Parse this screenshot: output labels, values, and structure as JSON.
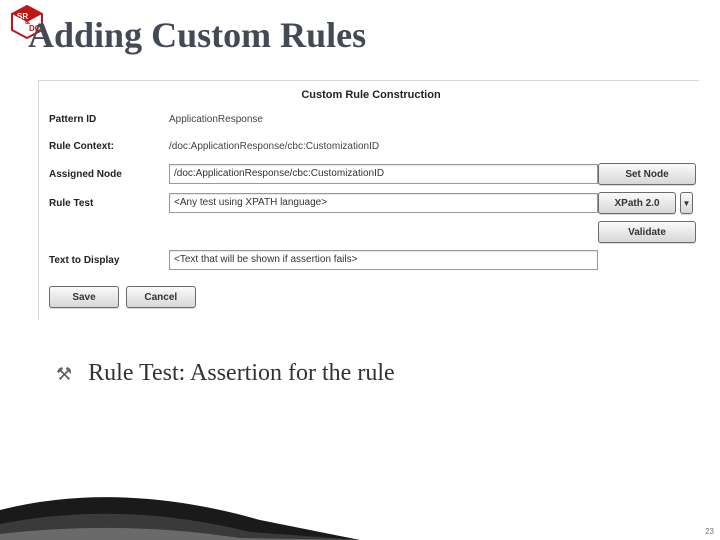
{
  "slide": {
    "title": "Adding Custom Rules",
    "page_number": "23",
    "bullet_glyph": "⚒",
    "bullet_text": "Rule Test: Assertion for the rule"
  },
  "logo": {
    "text_left": "SR",
    "amp": "&",
    "text_right": "DC"
  },
  "panel": {
    "header": "Custom Rule Construction",
    "rows": {
      "pattern_id": {
        "label": "Pattern ID",
        "value": "ApplicationResponse"
      },
      "rule_context": {
        "label": "Rule Context:",
        "value": "/doc:ApplicationResponse/cbc:CustomizationID"
      },
      "assigned_node": {
        "label": "Assigned Node",
        "value": "/doc:ApplicationResponse/cbc:CustomizationID",
        "button": "Set Node"
      },
      "rule_test": {
        "label": "Rule Test",
        "value": "<Any test using XPATH language>",
        "xpath_btn": "XPath 2.0",
        "validate_btn": "Validate"
      },
      "text_to_display": {
        "label": "Text to Display",
        "value": "<Text that will be shown if assertion fails>"
      }
    },
    "actions": {
      "save": "Save",
      "cancel": "Cancel"
    }
  }
}
